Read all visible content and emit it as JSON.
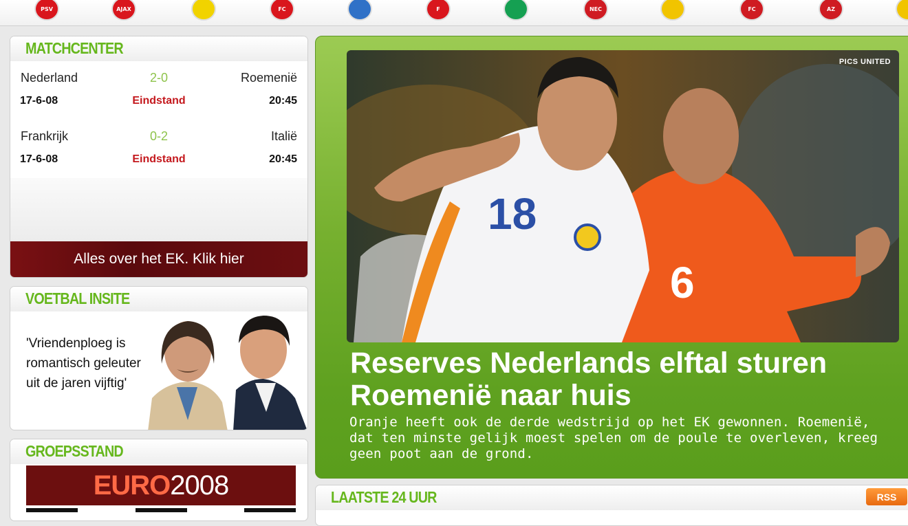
{
  "clubs": [
    {
      "name": "psv-icon",
      "abbr": "PSV",
      "color": "#d9161d"
    },
    {
      "name": "ajax-icon",
      "abbr": "AJAX",
      "color": "#d9161d"
    },
    {
      "name": "vitesse-icon",
      "abbr": "",
      "color": "#f1d300"
    },
    {
      "name": "twente-icon",
      "abbr": "FC",
      "color": "#d9161d"
    },
    {
      "name": "heerenveen-icon",
      "abbr": "",
      "color": "#2f71c7"
    },
    {
      "name": "feyenoord-icon",
      "abbr": "F",
      "color": "#d9161d"
    },
    {
      "name": "groningen-icon",
      "abbr": "",
      "color": "#15a052"
    },
    {
      "name": "nec-icon",
      "abbr": "NEC",
      "color": "#cf1b22"
    },
    {
      "name": "roda-icon",
      "abbr": "",
      "color": "#f1c400"
    },
    {
      "name": "utrecht-icon",
      "abbr": "FC",
      "color": "#cf1b22"
    },
    {
      "name": "az-icon",
      "abbr": "AZ",
      "color": "#cf1b22"
    },
    {
      "name": "club-icon",
      "abbr": "",
      "color": "#f1c400"
    }
  ],
  "matchcenter": {
    "title": "MATCHCENTER",
    "matches": [
      {
        "home": "Nederland",
        "score": "2-0",
        "away": "Roemenië",
        "date": "17-6-08",
        "status": "Eindstand",
        "time": "20:45"
      },
      {
        "home": "Frankrijk",
        "score": "0-2",
        "away": "Italië",
        "date": "17-6-08",
        "status": "Eindstand",
        "time": "20:45"
      }
    ],
    "cta": "Alles over het EK. Klik hier"
  },
  "insite": {
    "title": "VOETBAL INSITE",
    "quote": "'Vriendenploeg is romantisch geleuter uit de jaren vijftig'"
  },
  "groepsstand": {
    "title": "GROEPSSTAND",
    "banner_bold": "EURO",
    "banner_year": "2008"
  },
  "hero": {
    "credit": "PICS UNITED",
    "title": "Reserves Nederlands elftal sturen Roemenië naar huis",
    "lead": "Oranje heeft ook de derde wedstrijd op het EK gewonnen. Roemenië, dat ten minste gelijk moest spelen om de poule te overleven, kreeg geen poot aan de grond."
  },
  "latest": {
    "title": "LAATSTE 24 UUR",
    "rss": "RSS"
  }
}
